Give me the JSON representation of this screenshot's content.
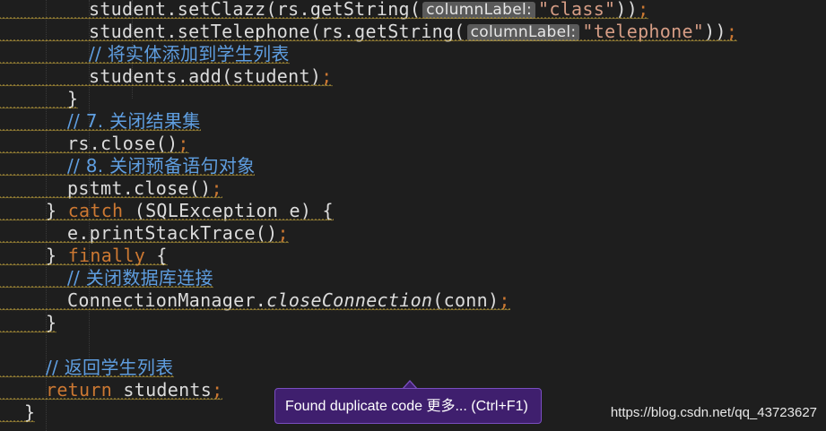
{
  "editor": {
    "lines": [
      {
        "indent": 8,
        "tokens": [
          {
            "t": "student.setClazz(rs.getString(",
            "c": "plain"
          },
          {
            "hint": "columnLabel:"
          },
          {
            "t": "\"class\"",
            "c": "str"
          },
          {
            "t": "))",
            "c": "plain"
          },
          {
            "t": ";",
            "c": "semi"
          }
        ]
      },
      {
        "indent": 8,
        "tokens": [
          {
            "t": "student.setTelephone(rs.getString(",
            "c": "plain"
          },
          {
            "hint": "columnLabel:"
          },
          {
            "t": "\"telephone\"",
            "c": "str"
          },
          {
            "t": "))",
            "c": "plain"
          },
          {
            "t": ";",
            "c": "semi"
          }
        ]
      },
      {
        "indent": 8,
        "tokens": [
          {
            "t": "// 将实体添加到学生列表",
            "c": "comment-blue"
          }
        ]
      },
      {
        "indent": 8,
        "tokens": [
          {
            "t": "students.add(student)",
            "c": "plain"
          },
          {
            "t": ";",
            "c": "semi"
          }
        ]
      },
      {
        "indent": 6,
        "tokens": [
          {
            "t": "}",
            "c": "plain"
          }
        ]
      },
      {
        "indent": 6,
        "tokens": [
          {
            "t": "// 7. 关闭结果集",
            "c": "comment-blue"
          }
        ]
      },
      {
        "indent": 6,
        "tokens": [
          {
            "t": "rs.close()",
            "c": "plain"
          },
          {
            "t": ";",
            "c": "semi"
          }
        ]
      },
      {
        "indent": 6,
        "tokens": [
          {
            "t": "// 8. 关闭预备语句对象",
            "c": "comment-blue"
          }
        ]
      },
      {
        "indent": 6,
        "tokens": [
          {
            "t": "pstmt.close()",
            "c": "plain"
          },
          {
            "t": ";",
            "c": "semi"
          }
        ]
      },
      {
        "indent": 4,
        "tokens": [
          {
            "t": "} ",
            "c": "plain"
          },
          {
            "t": "catch",
            "c": "kwc"
          },
          {
            "t": " (SQLException e) {",
            "c": "plain"
          }
        ]
      },
      {
        "indent": 6,
        "tokens": [
          {
            "t": "e.printStackTrace()",
            "c": "plain"
          },
          {
            "t": ";",
            "c": "semi"
          }
        ]
      },
      {
        "indent": 4,
        "tokens": [
          {
            "t": "} ",
            "c": "plain"
          },
          {
            "t": "finally",
            "c": "kwc"
          },
          {
            "t": " {",
            "c": "plain"
          }
        ]
      },
      {
        "indent": 6,
        "tokens": [
          {
            "t": "// 关闭数据库连接",
            "c": "comment-blue"
          }
        ]
      },
      {
        "indent": 6,
        "tokens": [
          {
            "t": "ConnectionManager.",
            "c": "plain"
          },
          {
            "t": "closeConnection",
            "c": "italic"
          },
          {
            "t": "(conn)",
            "c": "plain"
          },
          {
            "t": ";",
            "c": "semi"
          }
        ]
      },
      {
        "indent": 4,
        "tokens": [
          {
            "t": "}",
            "c": "plain"
          }
        ]
      },
      {
        "indent": 4,
        "tokens": []
      },
      {
        "indent": 4,
        "tokens": [
          {
            "t": "// 返回学生列表",
            "c": "comment-blue"
          }
        ]
      },
      {
        "indent": 4,
        "tokens": [
          {
            "t": "return",
            "c": "kwc"
          },
          {
            "t": " students",
            "c": "plain"
          },
          {
            "t": ";",
            "c": "semi"
          }
        ]
      },
      {
        "indent": 2,
        "tokens": [
          {
            "t": "}",
            "c": "plain"
          }
        ]
      }
    ]
  },
  "tooltip": {
    "text": "Found duplicate code",
    "more_label": "更多...",
    "shortcut": "(Ctrl+F1)"
  },
  "watermark": {
    "text": "https://blog.csdn.net/qq_43723627"
  },
  "colors": {
    "background": "#1e1e1e",
    "keyword": "#cc7832",
    "string": "#d69d85",
    "comment": "#5f9ee0",
    "tooltip_bg": "#3f1f6e",
    "tooltip_border": "#7a4ec0"
  }
}
